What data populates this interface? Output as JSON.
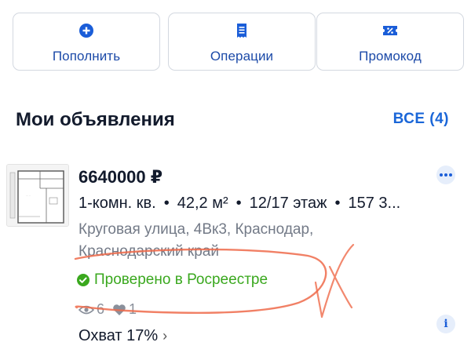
{
  "actions": [
    {
      "label": "Пополнить",
      "icon": "plus-circle-icon"
    },
    {
      "label": "Операции",
      "icon": "receipt-icon"
    },
    {
      "label": "Промокод",
      "icon": "ticket-percent-icon"
    }
  ],
  "section": {
    "title": "Мои объявления",
    "all_link": "ВСЕ (4)"
  },
  "listing": {
    "price": "6640000 ₽",
    "rooms": "1-комн. кв.",
    "area": "42,2 м²",
    "floor": "12/17 этаж",
    "extra": "157 3...",
    "address": "Круговая улица, 4Вк3, Краснодар, Краснодарский край",
    "verified": "Проверено в Росреестре",
    "views": "6",
    "likes": "1",
    "reach": "Охват 17%"
  },
  "colors": {
    "accent": "#1a66d8",
    "verified": "#3aa81e",
    "annotation": "#ef6a4a"
  }
}
